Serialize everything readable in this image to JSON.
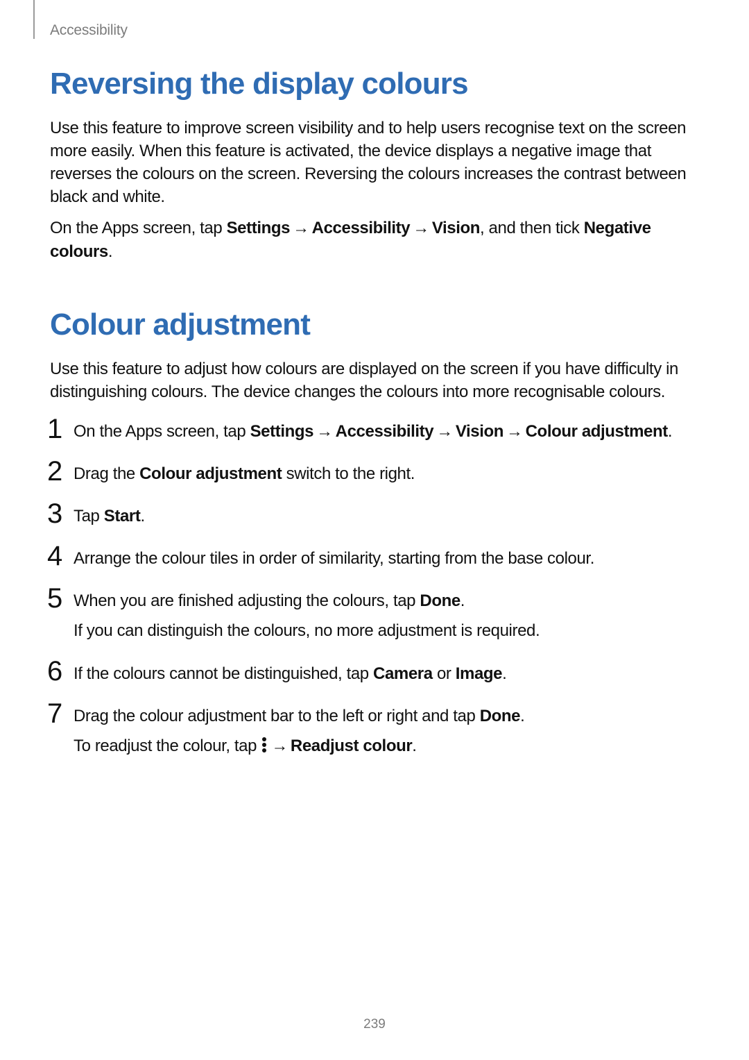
{
  "header": {
    "section": "Accessibility"
  },
  "page_number": "239",
  "sections": {
    "reversing": {
      "title": "Reversing the display colours",
      "para1": "Use this feature to improve screen visibility and to help users recognise text on the screen more easily. When this feature is activated, the device displays a negative image that reverses the colours on the screen. Reversing the colours increases the contrast between black and white.",
      "para2_prefix": "On the Apps screen, tap ",
      "para2_nav": {
        "a": "Settings",
        "b": "Accessibility",
        "c": "Vision"
      },
      "para2_mid": ", and then tick ",
      "para2_bold": "Negative colours",
      "para2_suffix": "."
    },
    "colour_adjust": {
      "title": "Colour adjustment",
      "intro": "Use this feature to adjust how colours are displayed on the screen if you have difficulty in distinguishing colours. The device changes the colours into more recognisable colours.",
      "steps": {
        "s1_prefix": "On the Apps screen, tap ",
        "s1_nav": {
          "a": "Settings",
          "b": "Accessibility",
          "c": "Vision",
          "d": "Colour adjustment"
        },
        "s1_suffix": ".",
        "s2_a": "Drag the ",
        "s2_b": "Colour adjustment",
        "s2_c": " switch to the right.",
        "s3_a": "Tap ",
        "s3_b": "Start",
        "s3_c": ".",
        "s4": "Arrange the colour tiles in order of similarity, starting from the base colour.",
        "s5_a": "When you are finished adjusting the colours, tap ",
        "s5_b": "Done",
        "s5_c": ".",
        "s5_sub": "If you can distinguish the colours, no more adjustment is required.",
        "s6_a": "If the colours cannot be distinguished, tap ",
        "s6_b": "Camera",
        "s6_c": " or ",
        "s6_d": "Image",
        "s6_e": ".",
        "s7_a": "Drag the colour adjustment bar to the left or right and tap ",
        "s7_b": "Done",
        "s7_c": ".",
        "s7_sub_a": "To readjust the colour, tap ",
        "s7_sub_arrow": " → ",
        "s7_sub_b": "Readjust colour",
        "s7_sub_c": "."
      }
    }
  },
  "glyphs": {
    "arrow": "→"
  }
}
